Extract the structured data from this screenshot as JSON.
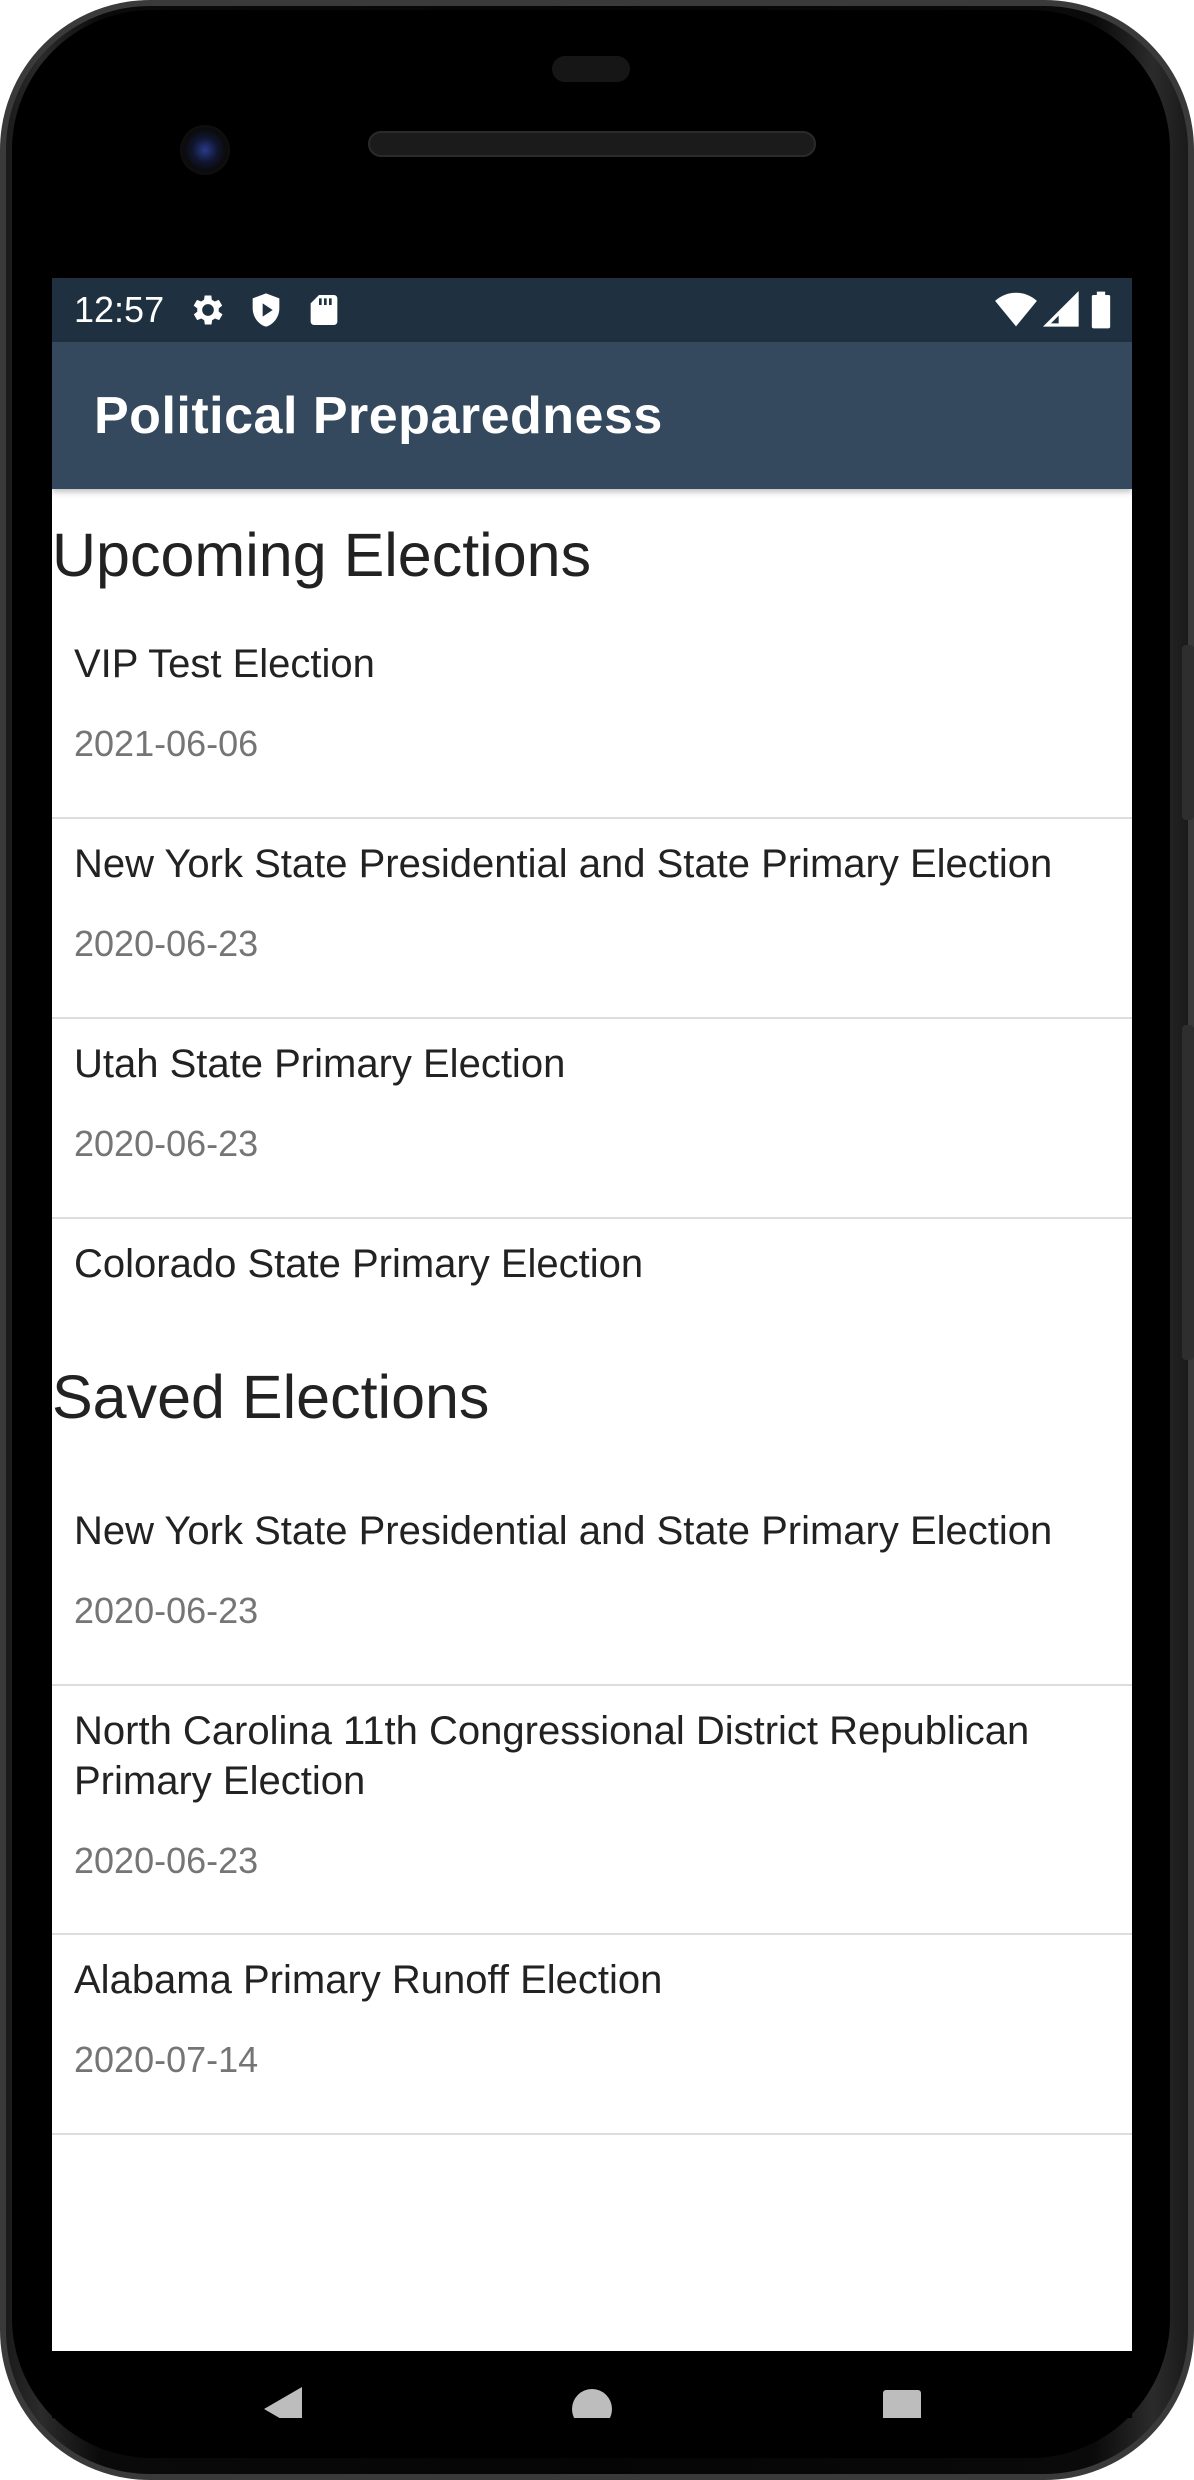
{
  "status_bar": {
    "time": "12:57",
    "left_icons": [
      "gear-icon",
      "shield-play-icon",
      "sd-card-icon"
    ],
    "right_icons": [
      "wifi-icon",
      "cell-signal-icon",
      "battery-icon"
    ]
  },
  "app_bar": {
    "title": "Political Preparedness"
  },
  "upcoming": {
    "header": "Upcoming Elections",
    "items": [
      {
        "name": "VIP Test Election",
        "date": "2021-06-06"
      },
      {
        "name": "New York State Presidential and State Primary Election",
        "date": "2020-06-23"
      },
      {
        "name": "Utah State Primary Election",
        "date": "2020-06-23"
      },
      {
        "name": "Colorado State Primary Election",
        "date": ""
      }
    ]
  },
  "saved": {
    "header": "Saved Elections",
    "items": [
      {
        "name": "New York State Presidential and State Primary Election",
        "date": "2020-06-23"
      },
      {
        "name": "North Carolina 11th Congressional District Republican Primary Election",
        "date": "2020-06-23"
      },
      {
        "name": "Alabama Primary Runoff Election",
        "date": "2020-07-14"
      }
    ]
  },
  "nav_bar": {
    "buttons": [
      "back-icon",
      "home-icon",
      "recents-icon"
    ]
  },
  "colors": {
    "status_bar": "#1f3140",
    "app_bar": "#35495e",
    "primary_text": "#222222",
    "secondary_text": "#757575",
    "divider": "#dddddd"
  }
}
